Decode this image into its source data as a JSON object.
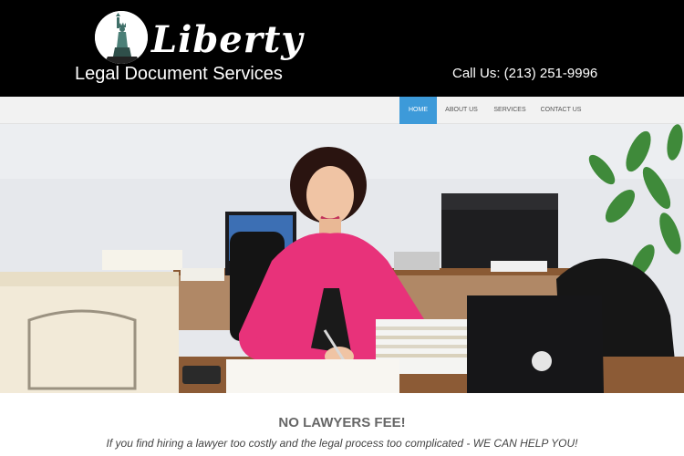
{
  "header": {
    "logo_script": "Liberty",
    "logo_subtitle": "Legal Document Services",
    "logo_icon": "statue-of-liberty-icon",
    "phone": "Call Us: (213) 251-9996"
  },
  "nav": {
    "items": [
      {
        "label": "HOME",
        "active": true
      },
      {
        "label": "ABOUT US",
        "active": false
      },
      {
        "label": "SERVICES",
        "active": false
      },
      {
        "label": "CONTACT US",
        "active": false
      }
    ]
  },
  "hero": {
    "image": "office-photo-woman-at-desk"
  },
  "content": {
    "headline": "NO LAWYERS FEE!",
    "tagline": "If you find hiring a lawyer too costly and the legal process too complicated -  WE CAN HELP YOU!"
  },
  "colors": {
    "header_bg": "#000000",
    "nav_bg": "#f2f2f2",
    "nav_active": "#3d9ad9",
    "jacket": "#e8327a"
  }
}
